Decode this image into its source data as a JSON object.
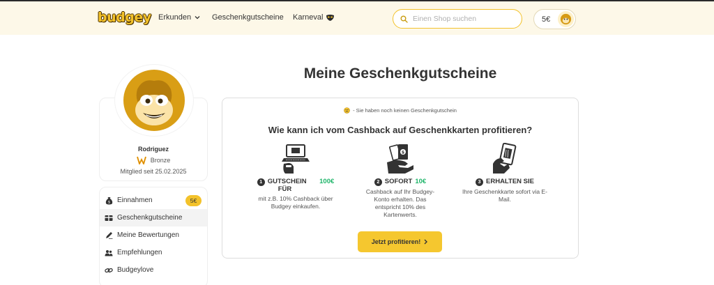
{
  "header": {
    "logo": "budgey",
    "nav": {
      "explore": "Erkunden",
      "giftcards": "Geschenkgutscheine",
      "carnival": "Karneval"
    },
    "search_placeholder": "Einen Shop suchen",
    "balance": "5€"
  },
  "page_title": "Meine Geschenkgutscheine",
  "profile": {
    "name": "Rodriguez",
    "tier": "Bronze",
    "member_since": "Mitglied seit 25.02.2025"
  },
  "menu": {
    "items": [
      {
        "label": "Einnahmen",
        "icon": "money-bag-icon",
        "badge": "5€"
      },
      {
        "label": "Geschenkgutscheine",
        "icon": "gift-card-icon",
        "active": true
      },
      {
        "label": "Meine Bewertungen",
        "icon": "pen-icon"
      },
      {
        "label": "Empfehlungen",
        "icon": "users-icon"
      },
      {
        "label": "Budgeylove",
        "icon": "link-icon"
      }
    ]
  },
  "content": {
    "notice": "- Sie haben noch keinen Geschenkgutschein",
    "heading": "Wie kann ich vom Cashback auf Geschenkkarten profitieren?",
    "steps": [
      {
        "num": "1",
        "title_a": "GUTSCHEIN",
        "title_b": "FÜR",
        "amount": "100€",
        "text": "mit z.B. 10% Cashback über Budgey einkaufen."
      },
      {
        "num": "2",
        "title_a": "SOFORT",
        "amount": "10€",
        "text": "Cashback auf Ihr Budgey-Konto erhalten. Das entspricht 10% des Kartenwerts."
      },
      {
        "num": "3",
        "title_a": "ERHALTEN SIE",
        "text": "Ihre Geschenkkarte sofort via E-Mail."
      }
    ],
    "cta": "Jetzt profitieren!"
  },
  "colors": {
    "accent": "#f3c22b",
    "green": "#1fb56a",
    "header_bg": "#fdf8e8"
  }
}
